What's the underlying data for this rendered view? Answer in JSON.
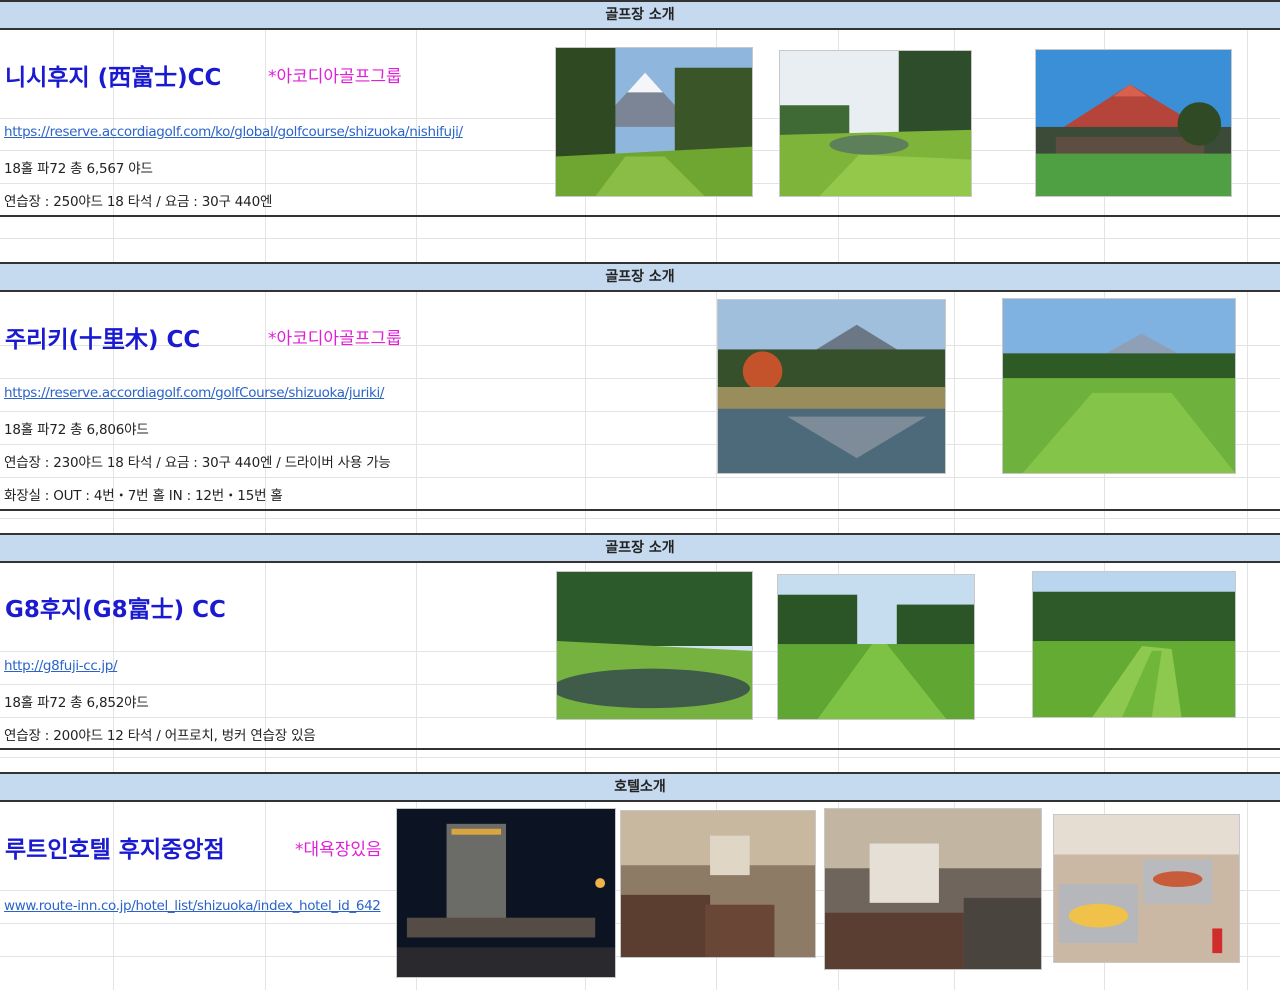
{
  "sections": [
    {
      "header": "골프장 소개",
      "name": "니시후지 (西富士)CC",
      "tag": "*아코디아골프그룹",
      "link": "https://reserve.accordiagolf.com/ko/global/golfcourse/shizuoka/nishifuji/",
      "lines": [
        "18홀 파72 총 6,567 야드",
        "연습장 : 250야드 18 타석 / 요금 : 30구 440엔"
      ],
      "photos": [
        "fuji-fairway-photo",
        "pond-green-photo",
        "red-fuji-clubhouse-photo"
      ]
    },
    {
      "header": "골프장 소개",
      "name": "주리키(十里木) CC",
      "tag": "*아코디아골프그룹",
      "link": "https://reserve.accordiagolf.com/golfCourse/shizuoka/juriki/",
      "lines": [
        "18홀 파72 총 6,806야드",
        "연습장 : 230야드 18 타석 / 요금 : 30구 440엔 / 드라이버 사용 가능",
        " 화장실 : OUT : 4번・7번 홀    IN : 12번・15번 홀"
      ],
      "photos": [
        "fuji-lake-reflection-photo",
        "fuji-fairway-forest-photo"
      ]
    },
    {
      "header": "골프장 소개",
      "name": "G8후지(G8富士) CC",
      "tag": "",
      "link": "http://g8fuji-cc.jp/",
      "lines": [
        "18홀 파72 총 6,852야드",
        "연습장 : 200야드 12 타석 / 어프로치, 벙커 연습장 있음"
      ],
      "photos": [
        "pond-forest-green-photo",
        "long-fairway-photo",
        "striped-fairway-photo"
      ]
    },
    {
      "header": "호텔소개",
      "name": "루트인호텔 후지중앙점",
      "tag": "*대욕장있음",
      "link": "www.route-inn.co.jp/hotel_list/shizuoka/index_hotel_id_642",
      "lines": [],
      "photos": [
        "hotel-exterior-night-photo",
        "twin-room-photo",
        "room-window-photo",
        "breakfast-buffet-photo"
      ]
    }
  ],
  "colors": {
    "header_bg": "#c5d9ef",
    "name": "#1a1ad0",
    "tag": "#e020d6",
    "link": "#2b64c8"
  }
}
